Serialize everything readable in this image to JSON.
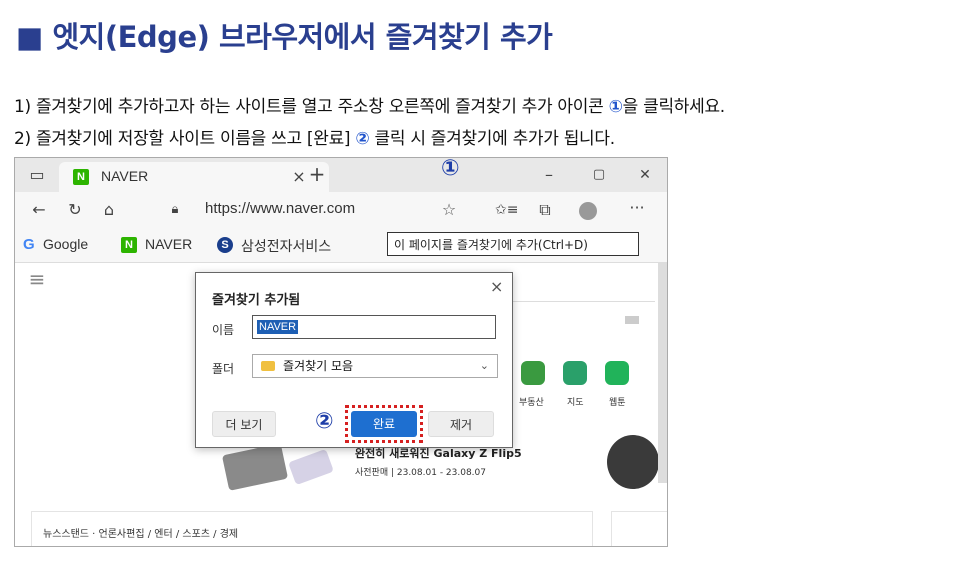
{
  "heading": "■ 엣지(Edge) 브라우저에서 즐겨찾기 추가",
  "steps": {
    "step1_pre": "1) 즐겨찾기에 추가하고자 하는 사이트를 열고 주소창 오른쪽에 즐겨찾기 추가 아이콘 ",
    "step1_mark": "①",
    "step1_post": "을 클릭하세요.",
    "step2_pre": "2) 즐겨찾기에 저장할 사이트 이름을 쓰고 [완료] ",
    "step2_mark": "②",
    "step2_post": " 클릭 시 즐겨찾기에 추가가 됩니다."
  },
  "browser": {
    "tab_title": "NAVER",
    "tab_close": "×",
    "new_tab": "+",
    "marker_1": "①",
    "window_controls": [
      "–",
      "▢",
      "✕"
    ],
    "url": "https://www.naver.com",
    "favorites_bar": [
      "Google",
      "NAVER",
      "삼성전자서비스"
    ],
    "tooltip": "이 페이지를 즐겨찾기에 추가(Ctrl+D)"
  },
  "dialog": {
    "title": "즐겨찾기 추가됨",
    "name_label": "이름",
    "name_value": "NAVER",
    "folder_label": "폴더",
    "folder_value": "즐겨찾기 모음",
    "more_button": "더 보기",
    "marker_2": "②",
    "done_button": "완료",
    "remove_button": "제거",
    "close": "×"
  },
  "naver_page": {
    "services": [
      "부동산",
      "지도",
      "웹툰"
    ],
    "promo_title": "완전히 새로워진 Galaxy Z Flip5",
    "promo_sub": "사전판매 | 23.08.01 - 23.08.07",
    "news_stand": "뉴스스탠드 · 언론사편집 / 엔터 / 스포츠 / 경제"
  },
  "colors": {
    "heading": "#2a3f8f",
    "marker": "#1e3ea8",
    "highlight_dots": "#d62020",
    "done_button": "#1e6fd0",
    "naver_green": "#2db400"
  }
}
